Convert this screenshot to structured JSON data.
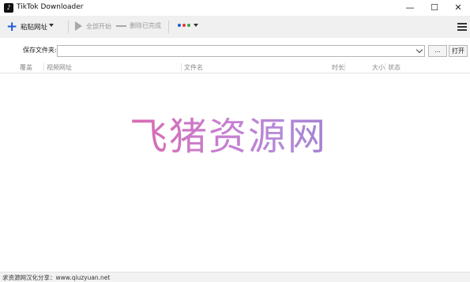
{
  "window": {
    "title": "TikTok Downloader",
    "app_icon_glyph": "♪",
    "controls": {
      "minimize": "—",
      "maximize": "☐",
      "close": "✕"
    }
  },
  "toolbar": {
    "add_label": "粘贴网址",
    "start_all_label": "全部开始",
    "delete_done_label": "删除已完成",
    "dots_colors": [
      "#1f5bd8",
      "#e53935",
      "#43a047",
      "#333333"
    ]
  },
  "save_folder": {
    "label": "保存文件夹:",
    "value": "",
    "browse_label": "...",
    "open_label": "打开"
  },
  "table": {
    "columns": [
      "覆盖",
      "视频网址",
      "文件名",
      "时长",
      "大小",
      "状态"
    ],
    "rows": []
  },
  "watermark": {
    "text": "飞猪资源网"
  },
  "status": {
    "text": "求资源网汉化分享：www.qiuzyuan.net"
  },
  "icons": [
    "app-logo-icon",
    "plus-icon",
    "chevron-down-icon",
    "play-icon",
    "dash-icon",
    "color-dots-icon",
    "hamburger-menu-icon"
  ]
}
